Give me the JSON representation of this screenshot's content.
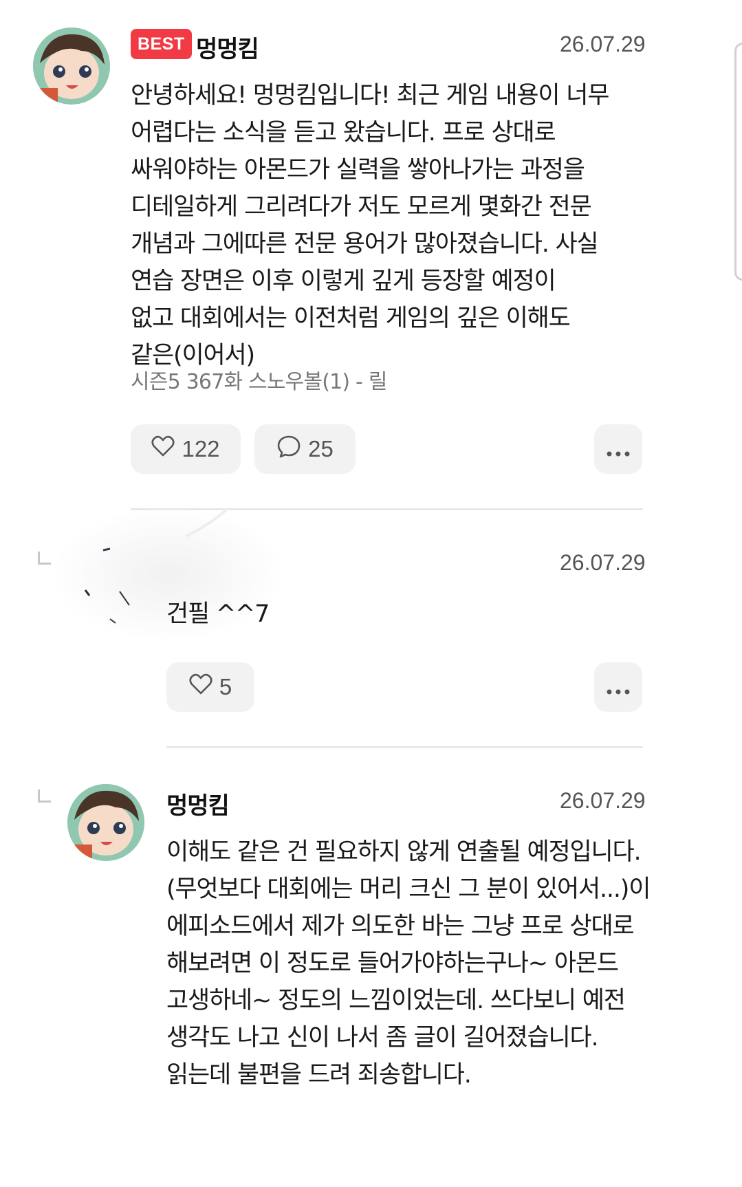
{
  "comments": [
    {
      "badge": "BEST",
      "username": "멍멍킴",
      "date": "26.07.29",
      "lines": [
        "안녕하세요! 멍멍킴입니다! 최근 게임 내용이 너무",
        "어렵다는 소식을 듣고 왔습니다. 프로 상대로",
        "싸워야하는 아몬드가 실력을 쌓아나가는 과정을",
        "디테일하게 그리려다가 저도 모르게 몇화간 전문",
        "개념과 그에따른 전문 용어가 많아졌습니다. 사실",
        "연습 장면은 이후 이렇게 깊게 등장할 예정이",
        "없고 대회에서는 이전처럼 게임의 깊은 이해도",
        "같은(이어서)"
      ],
      "episode": "시즌5 367화 스노우볼(1) - 릴",
      "likes": "122",
      "replies": "25"
    },
    {
      "date": "26.07.29",
      "text": "건필 ^^7",
      "likes": "5"
    },
    {
      "username": "멍멍킴",
      "date": "26.07.29",
      "lines": [
        "이해도 같은 건 필요하지 않게 연출될 예정입니다.",
        "(무엇보다 대회에는 머리 크신 그 분이 있어서...)이",
        "에피소드에서 제가 의도한 바는 그냥 프로 상대로",
        "해보려면 이 정도로 들어가야하는구나~ 아몬드",
        "고생하네~ 정도의 느낌이었는데. 쓰다보니 예전",
        "생각도 나고 신이 나서 좀 글이 길어졌습니다.",
        "읽는데 불편을 드려 죄송합니다."
      ]
    }
  ],
  "icons": {
    "like": "heart-icon",
    "reply": "speech-bubble-icon",
    "more": "more-dots-icon"
  },
  "colors": {
    "badge": "#f23a45",
    "pill_bg": "#f2f2f2",
    "divider": "#e8e8e8"
  }
}
